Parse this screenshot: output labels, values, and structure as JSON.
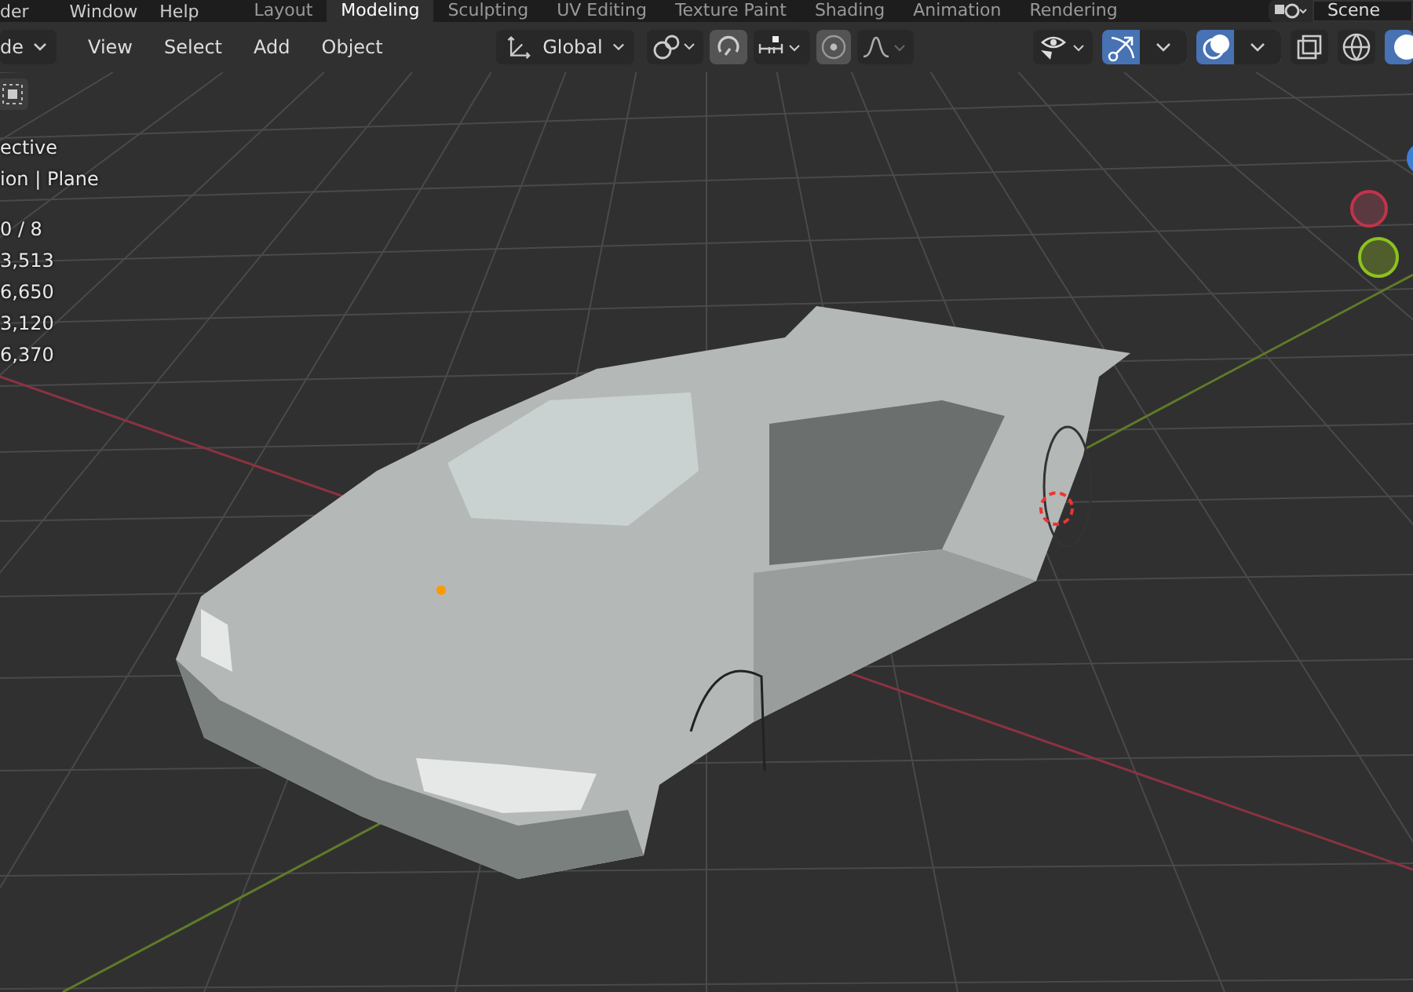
{
  "top_bar": {
    "menus": [
      "der",
      "Window",
      "Help"
    ],
    "tabs": [
      {
        "label": "Layout",
        "selected": false
      },
      {
        "label": "Modeling",
        "selected": true
      },
      {
        "label": "Sculpting",
        "selected": false
      },
      {
        "label": "UV Editing",
        "selected": false
      },
      {
        "label": "Texture Paint",
        "selected": false
      },
      {
        "label": "Shading",
        "selected": false
      },
      {
        "label": "Animation",
        "selected": false
      },
      {
        "label": "Rendering",
        "selected": false
      }
    ],
    "scene": {
      "value": "Scene"
    }
  },
  "header": {
    "mode": {
      "value": "de"
    },
    "menus": [
      "View",
      "Select",
      "Add",
      "Object"
    ],
    "orientation": {
      "value": "Global"
    },
    "tools": [
      {
        "kind": "pivot",
        "on": false
      },
      {
        "kind": "snap",
        "on": true
      },
      {
        "kind": "snap-target",
        "on": false
      },
      {
        "kind": "proportional",
        "on": true
      },
      {
        "kind": "falloff",
        "on": false
      }
    ],
    "right_tools": [
      {
        "kind": "visibility",
        "on": false
      },
      {
        "kind": "gizmo",
        "on": true
      },
      {
        "kind": "overlay",
        "on": true
      },
      {
        "kind": "xray",
        "on": false
      },
      {
        "kind": "wireframe",
        "on": false
      },
      {
        "kind": "solid",
        "on": true
      }
    ]
  },
  "viewport": {
    "info": [
      "ective",
      "ion | Plane"
    ],
    "stats": [
      "0 / 8",
      "3,513",
      "6,650",
      "3,120",
      "6,370"
    ]
  }
}
